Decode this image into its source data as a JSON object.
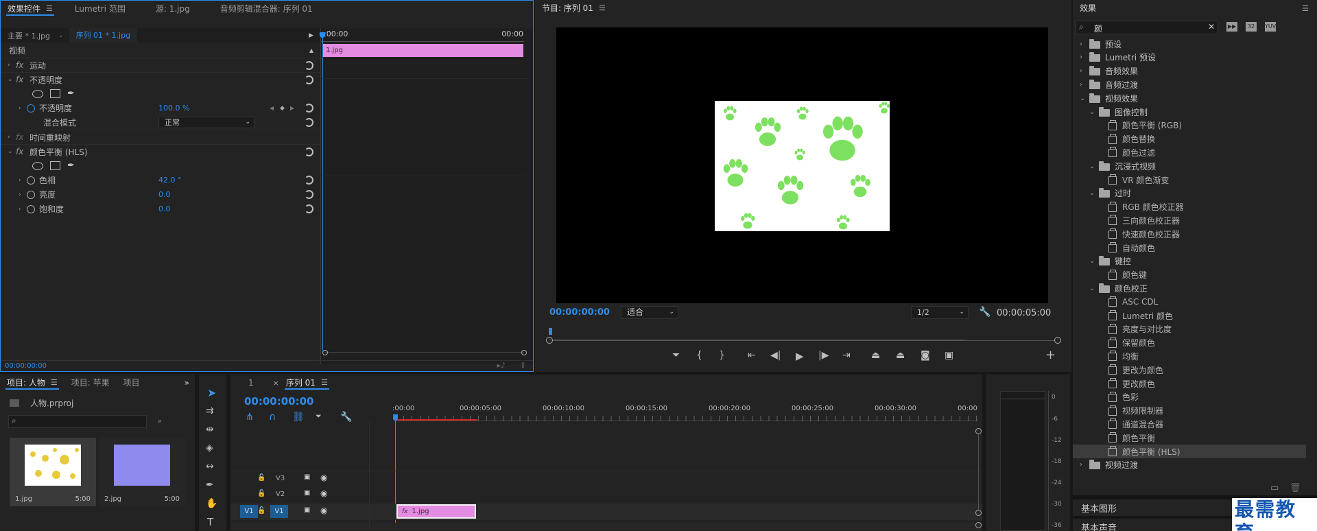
{
  "effect_controls": {
    "tabs": [
      "效果控件",
      "Lumetri 范围",
      "源: 1.jpg",
      "音频剪辑混合器: 序列 01"
    ],
    "master_label": "主要 * 1.jpg",
    "sequence_label": "序列 01 * 1.jpg",
    "timecode_start": ":00:00",
    "timecode_end": "00:00",
    "section_video": "视频",
    "clip_name": "1.jpg",
    "motion": "运动",
    "opacity": "不透明度",
    "opacity_param": "不透明度",
    "opacity_value": "100.0 %",
    "blend_mode_label": "混合模式",
    "blend_mode_value": "正常",
    "time_remap": "时间重映射",
    "color_balance": "颜色平衡 (HLS)",
    "hue_label": "色相",
    "hue_value": "42.0 °",
    "lightness_label": "亮度",
    "lightness_value": "0.0",
    "saturation_label": "饱和度",
    "saturation_value": "0.0",
    "footer_timecode": "00:00:00:00"
  },
  "program": {
    "title": "节目: 序列 01",
    "timecode": "00:00:00:00",
    "fit": "适合",
    "resolution": "1/2",
    "duration": "00:00:05:00"
  },
  "effects_panel": {
    "title": "效果",
    "search_value": "颜",
    "items": [
      {
        "label": "预设",
        "kind": "folder",
        "level": 0,
        "open": false
      },
      {
        "label": "Lumetri 预设",
        "kind": "folder",
        "level": 0,
        "open": false
      },
      {
        "label": "音频效果",
        "kind": "folder",
        "level": 0,
        "open": false
      },
      {
        "label": "音频过渡",
        "kind": "folder",
        "level": 0,
        "open": false
      },
      {
        "label": "视频效果",
        "kind": "folder",
        "level": 0,
        "open": true
      },
      {
        "label": "图像控制",
        "kind": "folder",
        "level": 1,
        "open": true
      },
      {
        "label": "颜色平衡 (RGB)",
        "kind": "effect",
        "level": 2
      },
      {
        "label": "颜色替换",
        "kind": "effect",
        "level": 2
      },
      {
        "label": "颜色过滤",
        "kind": "effect",
        "level": 2
      },
      {
        "label": "沉浸式视频",
        "kind": "folder",
        "level": 1,
        "open": true
      },
      {
        "label": "VR 颜色渐变",
        "kind": "effect",
        "level": 2
      },
      {
        "label": "过时",
        "kind": "folder",
        "level": 1,
        "open": true
      },
      {
        "label": "RGB 颜色校正器",
        "kind": "effect",
        "level": 2
      },
      {
        "label": "三向颜色校正器",
        "kind": "effect",
        "level": 2
      },
      {
        "label": "快速颜色校正器",
        "kind": "effect",
        "level": 2
      },
      {
        "label": "自动颜色",
        "kind": "effect",
        "level": 2
      },
      {
        "label": "键控",
        "kind": "folder",
        "level": 1,
        "open": true
      },
      {
        "label": "颜色键",
        "kind": "effect",
        "level": 2
      },
      {
        "label": "颜色校正",
        "kind": "folder",
        "level": 1,
        "open": true
      },
      {
        "label": "ASC CDL",
        "kind": "effect",
        "level": 2
      },
      {
        "label": "Lumetri 颜色",
        "kind": "effect",
        "level": 2
      },
      {
        "label": "亮度与对比度",
        "kind": "effect",
        "level": 2
      },
      {
        "label": "保留颜色",
        "kind": "effect",
        "level": 2
      },
      {
        "label": "均衡",
        "kind": "effect",
        "level": 2
      },
      {
        "label": "更改为颜色",
        "kind": "effect",
        "level": 2
      },
      {
        "label": "更改颜色",
        "kind": "effect",
        "level": 2
      },
      {
        "label": "色彩",
        "kind": "effect",
        "level": 2
      },
      {
        "label": "视频限制器",
        "kind": "effect",
        "level": 2
      },
      {
        "label": "通道混合器",
        "kind": "effect",
        "level": 2
      },
      {
        "label": "颜色平衡",
        "kind": "effect",
        "level": 2
      },
      {
        "label": "颜色平衡 (HLS)",
        "kind": "effect",
        "level": 2,
        "selected": true
      },
      {
        "label": "视频过渡",
        "kind": "folder",
        "level": 0,
        "open": false
      }
    ],
    "basic_graphics": "基本图形",
    "basic_sound": "基本声音"
  },
  "project": {
    "tabs": [
      "项目: 人物",
      "项目: 苹果",
      "项目"
    ],
    "file": "人物.prproj",
    "thumbs": [
      {
        "name": "1.jpg",
        "dur": "5:00"
      },
      {
        "name": "2.jpg",
        "dur": "5:00"
      }
    ]
  },
  "timeline": {
    "tabs": [
      "1",
      "序列 01"
    ],
    "timecode": "00:00:00:00",
    "ruler": [
      ":00:00",
      "00:00:05:00",
      "00:00:10:00",
      "00:00:15:00",
      "00:00:20:00",
      "00:00:25:00",
      "00:00:30:00",
      "00:00"
    ],
    "tracks": [
      "V3",
      "V2",
      "V1"
    ],
    "source_track": "V1",
    "clip": "1.jpg"
  },
  "meter": [
    "0",
    "-6",
    "-12",
    "-18",
    "-24",
    "-30",
    "-36"
  ],
  "watermark": "最需教育",
  "colors": {
    "accent": "#2d8ceb",
    "clip": "#e48be2",
    "paw": "#7ee060"
  }
}
